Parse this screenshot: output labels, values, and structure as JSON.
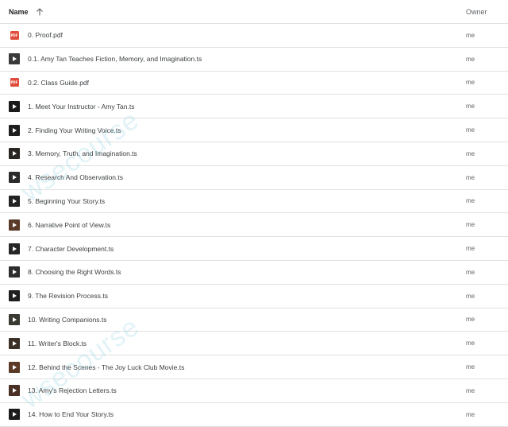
{
  "header": {
    "name_label": "Name",
    "owner_label": "Owner",
    "sort_direction": "ascending"
  },
  "watermark": {
    "text": "wsecourse"
  },
  "files": [
    {
      "name": "0. Proof.pdf",
      "owner": "me",
      "type": "pdf",
      "thumb": "#e14d3d"
    },
    {
      "name": "0.1. Amy Tan Teaches Fiction, Memory, and Imagination.ts",
      "owner": "me",
      "type": "video",
      "thumb": "#3a3a3a"
    },
    {
      "name": "0.2. Class Guide.pdf",
      "owner": "me",
      "type": "pdf",
      "thumb": "#e14d3d"
    },
    {
      "name": "1. Meet Your Instructor - Amy Tan.ts",
      "owner": "me",
      "type": "video",
      "thumb": "#1a1a1a"
    },
    {
      "name": "2. Finding Your Writing Voice.ts",
      "owner": "me",
      "type": "video",
      "thumb": "#1f1f1f"
    },
    {
      "name": "3. Memory, Truth, and Imagination.ts",
      "owner": "me",
      "type": "video",
      "thumb": "#2a2622"
    },
    {
      "name": "4. Research And Observation.ts",
      "owner": "me",
      "type": "video",
      "thumb": "#2b2b2b"
    },
    {
      "name": "5. Beginning Your Story.ts",
      "owner": "me",
      "type": "video",
      "thumb": "#232323"
    },
    {
      "name": "6. Narrative Point of View.ts",
      "owner": "me",
      "type": "video",
      "thumb": "#5a3b2a"
    },
    {
      "name": "7. Character Development.ts",
      "owner": "me",
      "type": "video",
      "thumb": "#262626"
    },
    {
      "name": "8. Choosing the Right Words.ts",
      "owner": "me",
      "type": "video",
      "thumb": "#2e2e2e"
    },
    {
      "name": "9. The Revision Process.ts",
      "owner": "me",
      "type": "video",
      "thumb": "#1e1e1e"
    },
    {
      "name": "10. Writing Companions.ts",
      "owner": "me",
      "type": "video",
      "thumb": "#3a3a32"
    },
    {
      "name": "11. Writer's Block.ts",
      "owner": "me",
      "type": "video",
      "thumb": "#3b2f26"
    },
    {
      "name": "12. Behind the Scenes - The Joy Luck Club Movie.ts",
      "owner": "me",
      "type": "video",
      "thumb": "#5b3a26"
    },
    {
      "name": "13. Amy's Rejection Letters.ts",
      "owner": "me",
      "type": "video",
      "thumb": "#4a3024"
    },
    {
      "name": "14. How to End Your Story.ts",
      "owner": "me",
      "type": "video",
      "thumb": "#1c1c1c"
    }
  ]
}
